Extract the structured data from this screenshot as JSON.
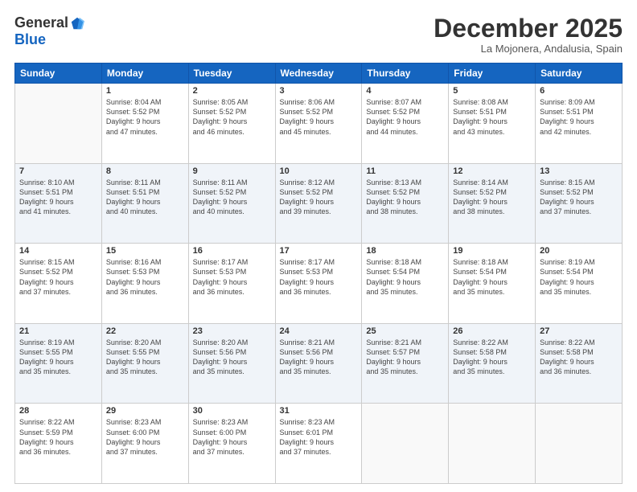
{
  "header": {
    "logo_general": "General",
    "logo_blue": "Blue",
    "month_title": "December 2025",
    "location": "La Mojonera, Andalusia, Spain"
  },
  "days_of_week": [
    "Sunday",
    "Monday",
    "Tuesday",
    "Wednesday",
    "Thursday",
    "Friday",
    "Saturday"
  ],
  "weeks": [
    {
      "shaded": false,
      "days": [
        {
          "num": "",
          "info": ""
        },
        {
          "num": "1",
          "info": "Sunrise: 8:04 AM\nSunset: 5:52 PM\nDaylight: 9 hours\nand 47 minutes."
        },
        {
          "num": "2",
          "info": "Sunrise: 8:05 AM\nSunset: 5:52 PM\nDaylight: 9 hours\nand 46 minutes."
        },
        {
          "num": "3",
          "info": "Sunrise: 8:06 AM\nSunset: 5:52 PM\nDaylight: 9 hours\nand 45 minutes."
        },
        {
          "num": "4",
          "info": "Sunrise: 8:07 AM\nSunset: 5:52 PM\nDaylight: 9 hours\nand 44 minutes."
        },
        {
          "num": "5",
          "info": "Sunrise: 8:08 AM\nSunset: 5:51 PM\nDaylight: 9 hours\nand 43 minutes."
        },
        {
          "num": "6",
          "info": "Sunrise: 8:09 AM\nSunset: 5:51 PM\nDaylight: 9 hours\nand 42 minutes."
        }
      ]
    },
    {
      "shaded": true,
      "days": [
        {
          "num": "7",
          "info": "Sunrise: 8:10 AM\nSunset: 5:51 PM\nDaylight: 9 hours\nand 41 minutes."
        },
        {
          "num": "8",
          "info": "Sunrise: 8:11 AM\nSunset: 5:51 PM\nDaylight: 9 hours\nand 40 minutes."
        },
        {
          "num": "9",
          "info": "Sunrise: 8:11 AM\nSunset: 5:52 PM\nDaylight: 9 hours\nand 40 minutes."
        },
        {
          "num": "10",
          "info": "Sunrise: 8:12 AM\nSunset: 5:52 PM\nDaylight: 9 hours\nand 39 minutes."
        },
        {
          "num": "11",
          "info": "Sunrise: 8:13 AM\nSunset: 5:52 PM\nDaylight: 9 hours\nand 38 minutes."
        },
        {
          "num": "12",
          "info": "Sunrise: 8:14 AM\nSunset: 5:52 PM\nDaylight: 9 hours\nand 38 minutes."
        },
        {
          "num": "13",
          "info": "Sunrise: 8:15 AM\nSunset: 5:52 PM\nDaylight: 9 hours\nand 37 minutes."
        }
      ]
    },
    {
      "shaded": false,
      "days": [
        {
          "num": "14",
          "info": "Sunrise: 8:15 AM\nSunset: 5:52 PM\nDaylight: 9 hours\nand 37 minutes."
        },
        {
          "num": "15",
          "info": "Sunrise: 8:16 AM\nSunset: 5:53 PM\nDaylight: 9 hours\nand 36 minutes."
        },
        {
          "num": "16",
          "info": "Sunrise: 8:17 AM\nSunset: 5:53 PM\nDaylight: 9 hours\nand 36 minutes."
        },
        {
          "num": "17",
          "info": "Sunrise: 8:17 AM\nSunset: 5:53 PM\nDaylight: 9 hours\nand 36 minutes."
        },
        {
          "num": "18",
          "info": "Sunrise: 8:18 AM\nSunset: 5:54 PM\nDaylight: 9 hours\nand 35 minutes."
        },
        {
          "num": "19",
          "info": "Sunrise: 8:18 AM\nSunset: 5:54 PM\nDaylight: 9 hours\nand 35 minutes."
        },
        {
          "num": "20",
          "info": "Sunrise: 8:19 AM\nSunset: 5:54 PM\nDaylight: 9 hours\nand 35 minutes."
        }
      ]
    },
    {
      "shaded": true,
      "days": [
        {
          "num": "21",
          "info": "Sunrise: 8:19 AM\nSunset: 5:55 PM\nDaylight: 9 hours\nand 35 minutes."
        },
        {
          "num": "22",
          "info": "Sunrise: 8:20 AM\nSunset: 5:55 PM\nDaylight: 9 hours\nand 35 minutes."
        },
        {
          "num": "23",
          "info": "Sunrise: 8:20 AM\nSunset: 5:56 PM\nDaylight: 9 hours\nand 35 minutes."
        },
        {
          "num": "24",
          "info": "Sunrise: 8:21 AM\nSunset: 5:56 PM\nDaylight: 9 hours\nand 35 minutes."
        },
        {
          "num": "25",
          "info": "Sunrise: 8:21 AM\nSunset: 5:57 PM\nDaylight: 9 hours\nand 35 minutes."
        },
        {
          "num": "26",
          "info": "Sunrise: 8:22 AM\nSunset: 5:58 PM\nDaylight: 9 hours\nand 35 minutes."
        },
        {
          "num": "27",
          "info": "Sunrise: 8:22 AM\nSunset: 5:58 PM\nDaylight: 9 hours\nand 36 minutes."
        }
      ]
    },
    {
      "shaded": false,
      "days": [
        {
          "num": "28",
          "info": "Sunrise: 8:22 AM\nSunset: 5:59 PM\nDaylight: 9 hours\nand 36 minutes."
        },
        {
          "num": "29",
          "info": "Sunrise: 8:23 AM\nSunset: 6:00 PM\nDaylight: 9 hours\nand 37 minutes."
        },
        {
          "num": "30",
          "info": "Sunrise: 8:23 AM\nSunset: 6:00 PM\nDaylight: 9 hours\nand 37 minutes."
        },
        {
          "num": "31",
          "info": "Sunrise: 8:23 AM\nSunset: 6:01 PM\nDaylight: 9 hours\nand 37 minutes."
        },
        {
          "num": "",
          "info": ""
        },
        {
          "num": "",
          "info": ""
        },
        {
          "num": "",
          "info": ""
        }
      ]
    }
  ]
}
